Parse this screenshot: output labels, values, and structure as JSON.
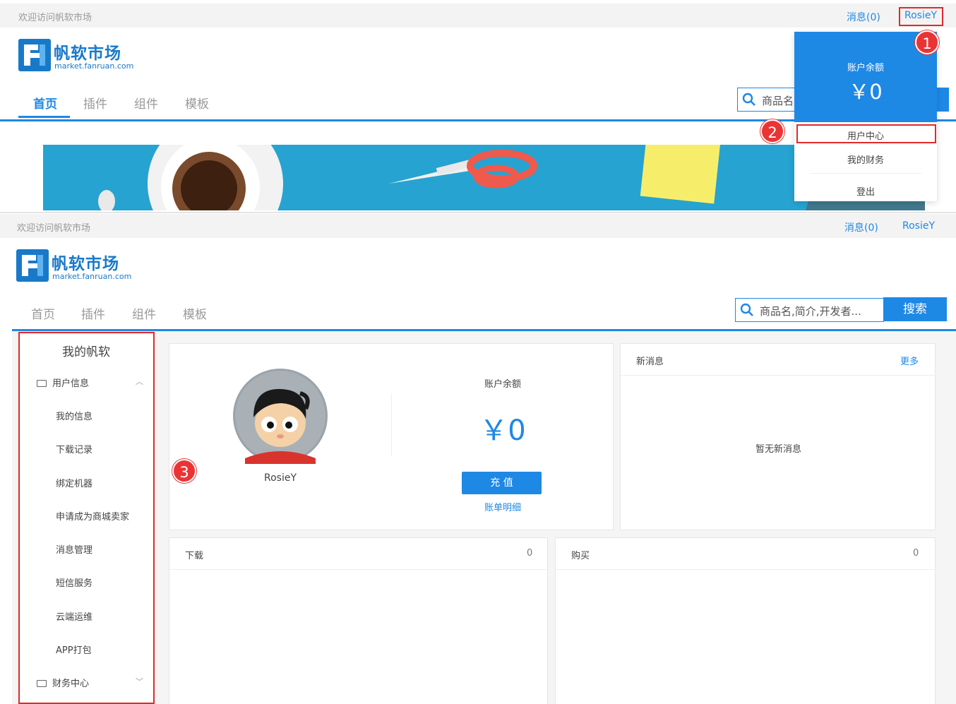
{
  "top": {
    "welcome": "欢迎访问帆软市场",
    "messages": "消息(0)",
    "username": "RosieY"
  },
  "logo": {
    "name": "帆软市场",
    "domain": "market.fanruan.com"
  },
  "nav": {
    "items": [
      "首页",
      "插件",
      "组件",
      "模板"
    ],
    "active_index_first_view": 0
  },
  "search": {
    "placeholder_partial": "商品名",
    "placeholder": "商品名,简介,开发者...",
    "button": "搜索"
  },
  "dropdown": {
    "balance_label": "账户余额",
    "balance_amount": "￥0",
    "items": [
      "用户中心",
      "我的财务",
      "登出"
    ]
  },
  "badges": [
    "1",
    "2",
    "3"
  ],
  "sidebar": {
    "title": "我的帆软",
    "group_user": "用户信息",
    "items": [
      "我的信息",
      "下载记录",
      "绑定机器",
      "申请成为商城卖家",
      "消息管理",
      "短信服务",
      "云端运维",
      "APP打包"
    ],
    "group_finance": "财务中心"
  },
  "profile": {
    "username": "RosieY",
    "balance_label": "账户余额",
    "balance_amount": "￥0",
    "recharge": "充 值",
    "bill_detail": "账单明细"
  },
  "messages_card": {
    "title": "新消息",
    "more": "更多",
    "empty": "暂无新消息"
  },
  "downloads_card": {
    "title": "下载",
    "count": "0"
  },
  "purchases_card": {
    "title": "购买",
    "count": "0"
  },
  "colors": {
    "accent": "#1e88e5",
    "highlight": "#e02a2a",
    "badge": "#ea3434"
  }
}
